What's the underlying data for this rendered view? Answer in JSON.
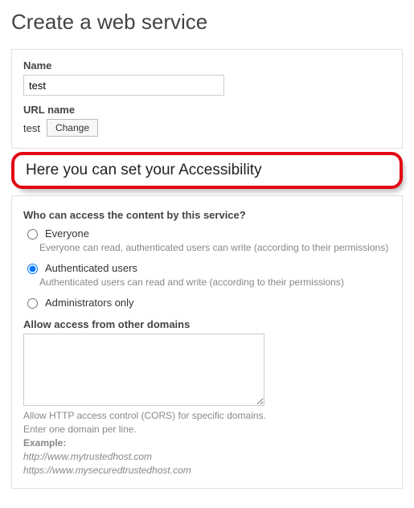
{
  "page": {
    "title": "Create a web service"
  },
  "panel1": {
    "name_label": "Name",
    "name_value": "test",
    "url_label": "URL name",
    "url_value": "test",
    "change_btn": "Change"
  },
  "callout": {
    "text": "Here you can set your Accessibility"
  },
  "access": {
    "question": "Who can access the content by this service?",
    "options": [
      {
        "label": "Everyone",
        "desc": "Everyone can read, authenticated users can write (according to their permissions)",
        "checked": false
      },
      {
        "label": "Authenticated users",
        "desc": "Authenticated users can read and write (according to their permissions)",
        "checked": true
      },
      {
        "label": "Administrators only",
        "desc": "",
        "checked": false
      }
    ],
    "domains_label": "Allow access from other domains",
    "domains_value": "",
    "help_line1": "Allow HTTP access control (CORS) for specific domains.",
    "help_line2": "Enter one domain per line.",
    "example_label": "Example:",
    "example1": "http://www.mytrustedhost.com",
    "example2": "https://www.mysecuredtrustedhost.com"
  }
}
